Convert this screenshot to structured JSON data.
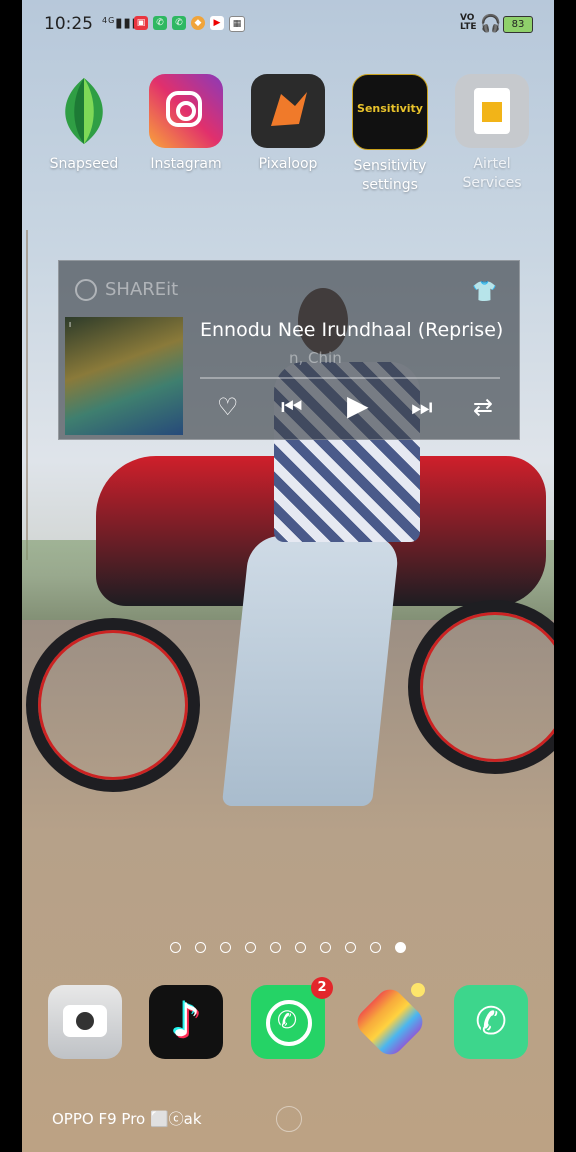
{
  "status_bar": {
    "time": "10:25",
    "signal": "4G",
    "volte": "VoLTE",
    "battery": "83"
  },
  "apps": [
    {
      "label": "Snapseed",
      "icon": "snapseed-icon"
    },
    {
      "label": "Instagram",
      "icon": "instagram-icon"
    },
    {
      "label": "Pixaloop",
      "icon": "pixaloop-icon"
    },
    {
      "label": "Sensitivity settings",
      "icon": "sensitivity-icon",
      "icon_text": "Sensitivity"
    },
    {
      "label": "Airtel Services",
      "icon": "sim-card-icon"
    }
  ],
  "music_widget": {
    "source": "SHAREit",
    "song_title": "Ennodu Nee Irundhaal (Reprise)",
    "artist": "n, Chin",
    "album_caption": "I"
  },
  "page_indicator": {
    "total": 10,
    "active_index": 9
  },
  "dock": [
    {
      "name": "camera",
      "icon": "camera-icon"
    },
    {
      "name": "tiktok",
      "icon": "tiktok-icon"
    },
    {
      "name": "whatsapp",
      "icon": "whatsapp-icon",
      "badge": "2"
    },
    {
      "name": "sharechat",
      "icon": "sharechat-icon"
    },
    {
      "name": "phone",
      "icon": "phone-icon"
    }
  ],
  "footer": {
    "watermark": "OPPO F9 Pro ⬜ⓒak"
  },
  "colors": {
    "instagram": "#d6249f",
    "pixaloop": "#2b2b2b",
    "whatsapp": "#25d366",
    "phone": "#3dd68c",
    "badge": "#e3262b"
  }
}
